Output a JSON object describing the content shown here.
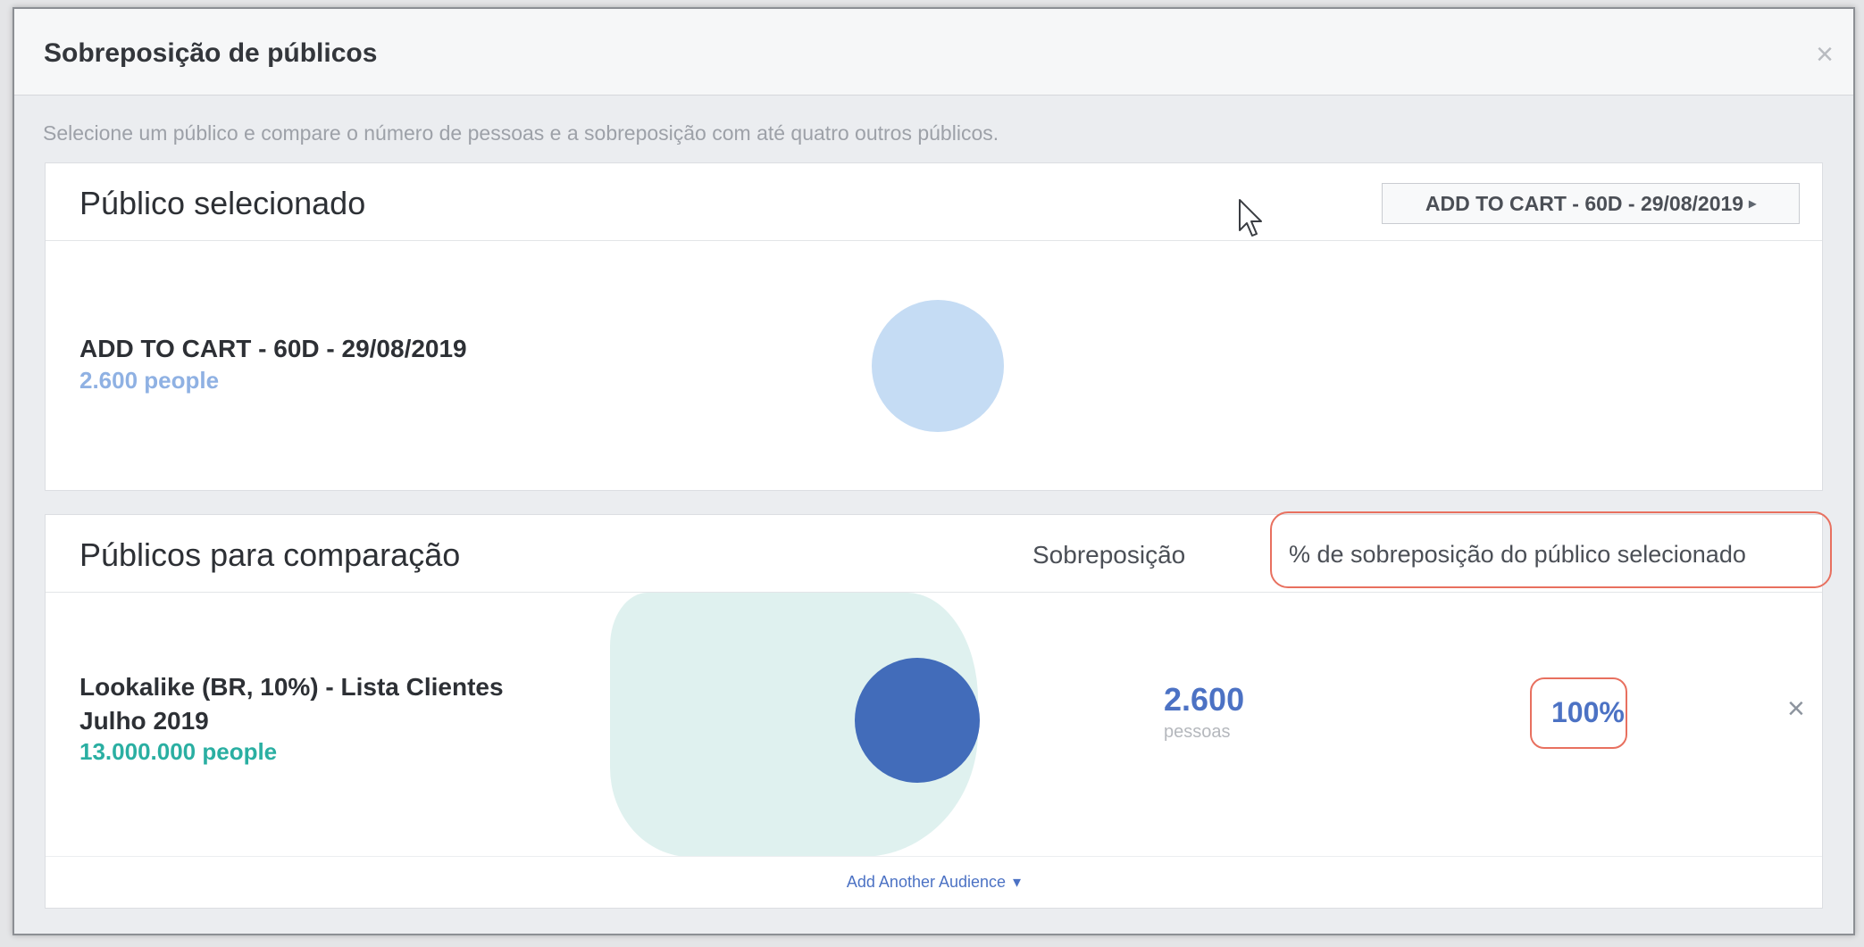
{
  "dialog": {
    "title": "Sobreposição de públicos",
    "close": "×",
    "subtitle": "Selecione um público e compare o número de pessoas e a sobreposição com até quatro outros públicos."
  },
  "selected": {
    "header": "Público selecionado",
    "dropdown_label": "ADD TO CART - 60D - 29/08/2019",
    "dropdown_caret": "▸",
    "audience_name": "ADD TO CART - 60D - 29/08/2019",
    "audience_size": "2.600 people"
  },
  "comparison": {
    "header": "Públicos para comparação",
    "col_overlap": "Sobreposição",
    "col_percent": "% de sobreposição do público selecionado",
    "rows": [
      {
        "name_line1": "Lookalike (BR, 10%) - Lista Clientes",
        "name_line2": "Julho 2019",
        "size": "13.000.000 people",
        "overlap_value": "2.600",
        "overlap_unit": "pessoas",
        "overlap_percent": "100%",
        "remove": "×"
      }
    ],
    "add_another": "Add Another Audience",
    "add_caret": "▾"
  },
  "colors": {
    "selected_bubble": "#c5dcf4",
    "comparison_bubble": "#426cba",
    "comparison_area": "#dff1ef",
    "highlight_outline": "#e8705f"
  }
}
